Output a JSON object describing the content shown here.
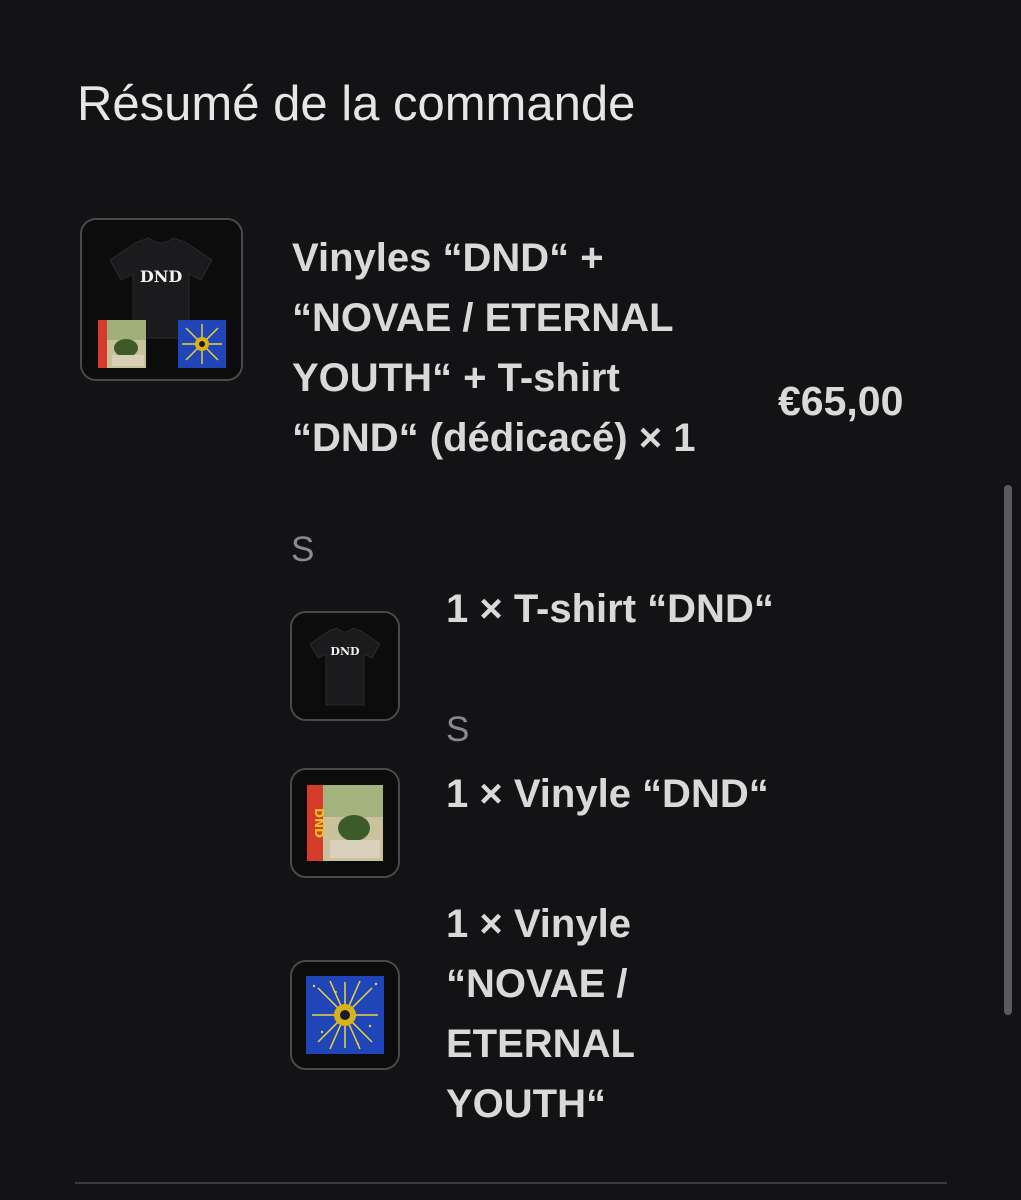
{
  "summary": {
    "title": "Résumé de la commande"
  },
  "product": {
    "name": "Vinyles “DND“ + “NOVAE / ETERNAL YOUTH“ + T-shirt “DND“ (dédicacé) × 1",
    "variant": "S",
    "price": "€65,00",
    "image_label": "DND",
    "components": [
      {
        "label": "1 × T-shirt “DND“",
        "variant": "S",
        "image_label": "DND"
      },
      {
        "label": "1 × Vinyle “DND“",
        "image_label": "DND"
      },
      {
        "label": "1 × Vinyle “NOVAE / ETERNAL YOUTH“"
      }
    ]
  },
  "colors": {
    "background": "#131315",
    "text": "#d9d9d9",
    "muted_text": "#8a8a8d",
    "thumb_border": "#4a4a4d",
    "vinyl_novae_blue": "#1f45b8",
    "vinyl_dnd_red": "#d63a2a"
  }
}
